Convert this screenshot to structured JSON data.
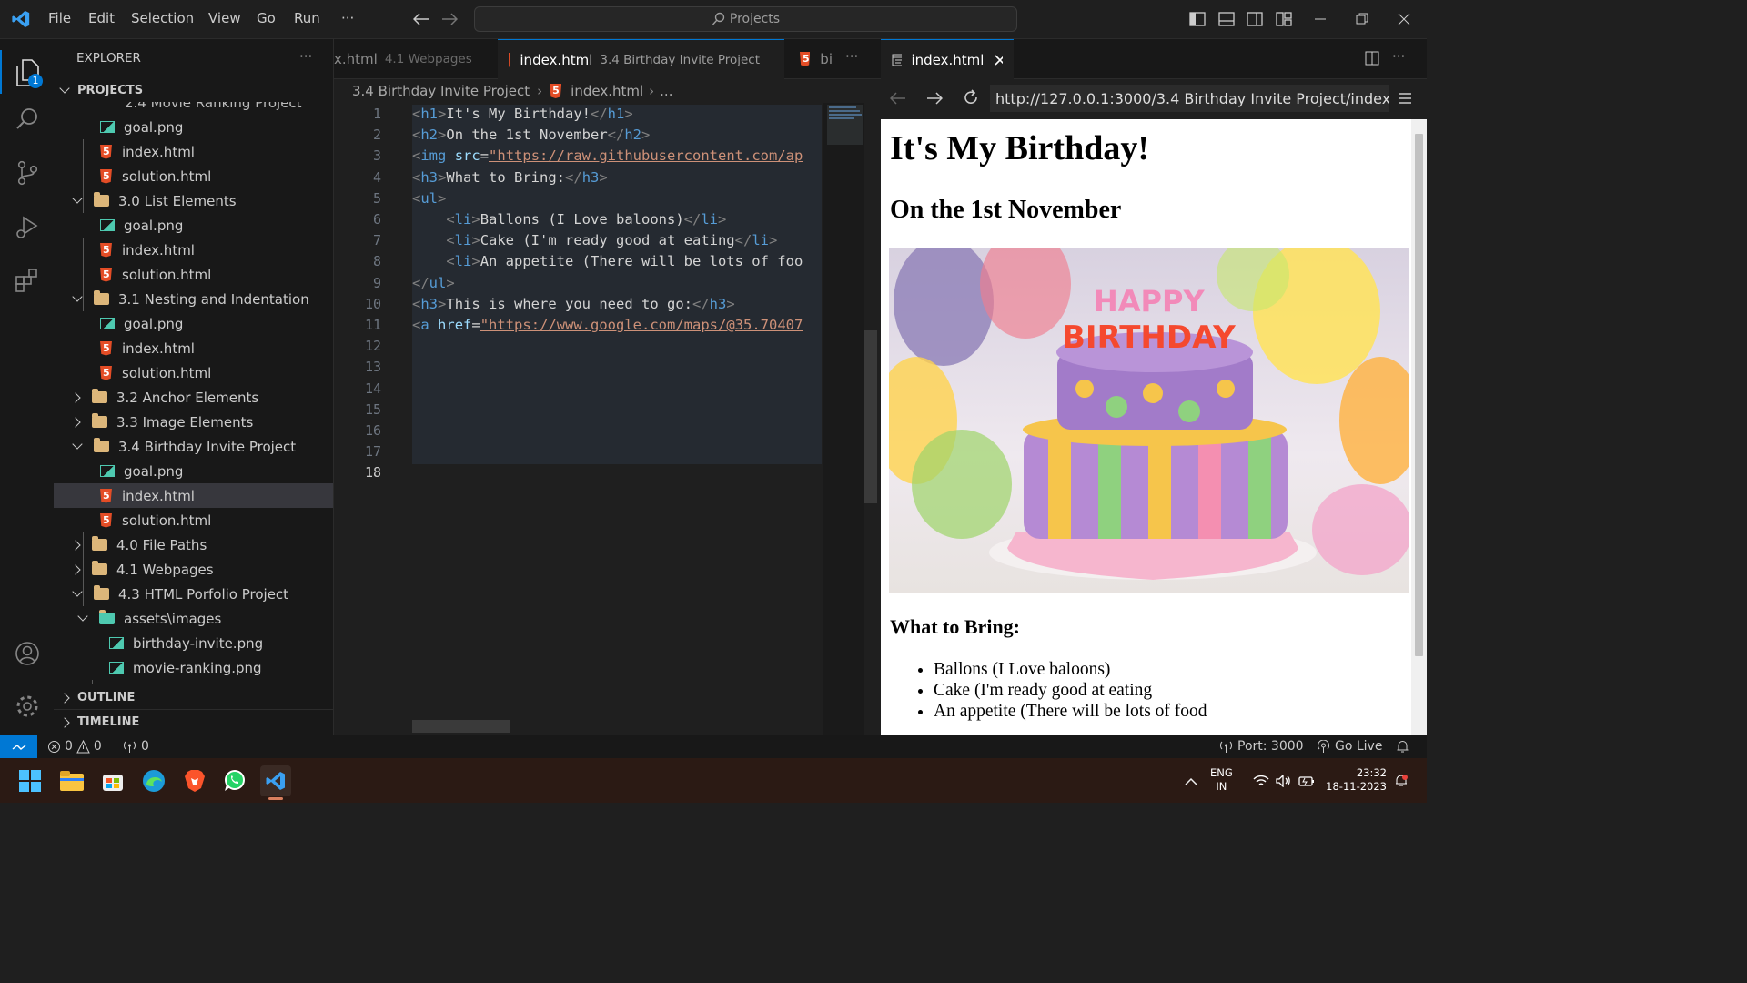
{
  "menu": [
    "File",
    "Edit",
    "Selection",
    "View",
    "Go",
    "Run",
    "···"
  ],
  "command_center": "Projects",
  "explorer": {
    "title": "EXPLORER",
    "more": "···",
    "projects_label": "PROJECTS",
    "partial_item": "2.4 Movie Ranking Project",
    "items": [
      {
        "label": "goal.png",
        "type": "image",
        "indent": 2
      },
      {
        "label": "index.html",
        "type": "html",
        "indent": 2
      },
      {
        "label": "solution.html",
        "type": "html",
        "indent": 2
      },
      {
        "label": "3.0 List Elements",
        "type": "folder-open",
        "indent": 1
      },
      {
        "label": "goal.png",
        "type": "image",
        "indent": 2
      },
      {
        "label": "index.html",
        "type": "html",
        "indent": 2
      },
      {
        "label": "solution.html",
        "type": "html",
        "indent": 2
      },
      {
        "label": "3.1 Nesting and Indentation",
        "type": "folder-open",
        "indent": 1
      },
      {
        "label": "goal.png",
        "type": "image",
        "indent": 2
      },
      {
        "label": "index.html",
        "type": "html",
        "indent": 2
      },
      {
        "label": "solution.html",
        "type": "html",
        "indent": 2
      },
      {
        "label": "3.2 Anchor Elements",
        "type": "folder",
        "indent": 1
      },
      {
        "label": "3.3 Image Elements",
        "type": "folder",
        "indent": 1
      },
      {
        "label": "3.4 Birthday Invite Project",
        "type": "folder-open",
        "indent": 1
      },
      {
        "label": "goal.png",
        "type": "image",
        "indent": 2
      },
      {
        "label": "index.html",
        "type": "html",
        "indent": 2,
        "selected": true
      },
      {
        "label": "solution.html",
        "type": "html",
        "indent": 2
      },
      {
        "label": "4.0 File Paths",
        "type": "folder",
        "indent": 1
      },
      {
        "label": "4.1 Webpages",
        "type": "folder",
        "indent": 1
      },
      {
        "label": "4.3 HTML Porfolio Project",
        "type": "folder-open",
        "indent": 1
      },
      {
        "label": "assets\\images",
        "type": "folder-open",
        "indent": 2
      },
      {
        "label": "birthday-invite.png",
        "type": "image",
        "indent": 3
      },
      {
        "label": "movie-ranking.png",
        "type": "image",
        "indent": 3
      }
    ],
    "outline": "OUTLINE",
    "timeline": "TIMELINE"
  },
  "activity_badge": "1",
  "tabs": [
    {
      "name": "x.html",
      "desc": "4.1 Webpages"
    },
    {
      "name": "index.html",
      "desc": "3.4 Birthday Invite Project",
      "active": true
    },
    {
      "name": "bi",
      "desc": ""
    }
  ],
  "tab_more": "···",
  "breadcrumb": {
    "folder": "3.4 Birthday Invite Project",
    "file": "index.html",
    "rest": "..."
  },
  "code_lines": [
    [
      [
        "tg",
        "<"
      ],
      [
        "tn",
        "h1"
      ],
      [
        "tg",
        ">"
      ],
      [
        "tx",
        "It's My Birthday!"
      ],
      [
        "tg",
        "</"
      ],
      [
        "tn",
        "h1"
      ],
      [
        "tg",
        ">"
      ]
    ],
    [
      [
        "tg",
        "<"
      ],
      [
        "tn",
        "h2"
      ],
      [
        "tg",
        ">"
      ],
      [
        "tx",
        "On the 1st November"
      ],
      [
        "tg",
        "</"
      ],
      [
        "tn",
        "h2"
      ],
      [
        "tg",
        ">"
      ]
    ],
    [
      [
        "tg",
        "<"
      ],
      [
        "tn",
        "img"
      ],
      [
        "tx",
        " "
      ],
      [
        "at",
        "src"
      ],
      [
        "tx",
        "="
      ],
      [
        "st",
        "\"https://raw.githubusercontent.com/ap"
      ]
    ],
    [
      [
        "tg",
        "<"
      ],
      [
        "tn",
        "h3"
      ],
      [
        "tg",
        ">"
      ],
      [
        "tx",
        "What to Bring:"
      ],
      [
        "tg",
        "</"
      ],
      [
        "tn",
        "h3"
      ],
      [
        "tg",
        ">"
      ]
    ],
    [
      [
        "tg",
        "<"
      ],
      [
        "tn",
        "ul"
      ],
      [
        "tg",
        ">"
      ]
    ],
    [
      [
        "tx",
        "    "
      ],
      [
        "tg",
        "<"
      ],
      [
        "tn",
        "li"
      ],
      [
        "tg",
        ">"
      ],
      [
        "tx",
        "Ballons (I Love baloons)"
      ],
      [
        "tg",
        "</"
      ],
      [
        "tn",
        "li"
      ],
      [
        "tg",
        ">"
      ]
    ],
    [
      [
        "tx",
        "    "
      ],
      [
        "tg",
        "<"
      ],
      [
        "tn",
        "li"
      ],
      [
        "tg",
        ">"
      ],
      [
        "tx",
        "Cake (I'm ready good at eating"
      ],
      [
        "tg",
        "</"
      ],
      [
        "tn",
        "li"
      ],
      [
        "tg",
        ">"
      ]
    ],
    [
      [
        "tx",
        "    "
      ],
      [
        "tg",
        "<"
      ],
      [
        "tn",
        "li"
      ],
      [
        "tg",
        ">"
      ],
      [
        "tx",
        "An appetite (There will be lots of foo"
      ]
    ],
    [
      [
        "tg",
        "</"
      ],
      [
        "tn",
        "ul"
      ],
      [
        "tg",
        ">"
      ]
    ],
    [
      [
        "tg",
        "<"
      ],
      [
        "tn",
        "h3"
      ],
      [
        "tg",
        ">"
      ],
      [
        "tx",
        "This is where you need to go:"
      ],
      [
        "tg",
        "</"
      ],
      [
        "tn",
        "h3"
      ],
      [
        "tg",
        ">"
      ]
    ],
    [
      [
        "tg",
        "<"
      ],
      [
        "tn",
        "a"
      ],
      [
        "tx",
        " "
      ],
      [
        "at",
        "href"
      ],
      [
        "tx",
        "="
      ],
      [
        "st",
        "\"https://www.google.com/maps/@35.70407"
      ]
    ],
    [],
    [],
    [],
    [],
    [],
    [],
    []
  ],
  "line_numbers": [
    "1",
    "2",
    "3",
    "4",
    "5",
    "6",
    "7",
    "8",
    "9",
    "10",
    "11",
    "12",
    "13",
    "14",
    "15",
    "16",
    "17",
    "18"
  ],
  "preview": {
    "tab_title": "index.html",
    "url": "http://127.0.0.1:3000/3.4 Birthday Invite Project/index.html",
    "h1": "It's My Birthday!",
    "h2": "On the 1st November",
    "h3": "What to Bring:",
    "list": [
      "Ballons (I Love baloons)",
      "Cake (I'm ready good at eating",
      "An appetite (There will be lots of food"
    ],
    "cake_text_1": "HAPPY",
    "cake_text_2": "BIRTHDAY"
  },
  "status": {
    "errors": "0",
    "warnings": "0",
    "ports": "0",
    "port": "Port: 3000",
    "golive": "Go Live"
  },
  "tray": {
    "lang1": "ENG",
    "lang2": "IN",
    "time": "23:32",
    "date": "18-11-2023"
  }
}
